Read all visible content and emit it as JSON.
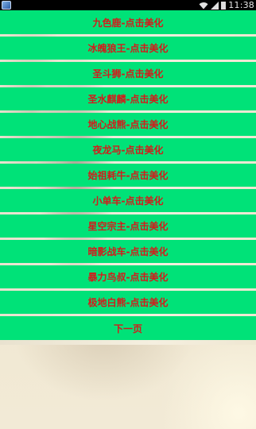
{
  "status_bar": {
    "time": "11:38",
    "icons": [
      "app-icon",
      "wifi-icon",
      "signal-icon",
      "battery-icon"
    ]
  },
  "colors": {
    "button_bg": "#00e278",
    "button_text": "#d41a1a",
    "status_bar_bg": "#000000"
  },
  "menu": {
    "items": [
      {
        "label": "九色鹿-点击美化"
      },
      {
        "label": "冰魄狼王-点击美化"
      },
      {
        "label": "圣斗狮-点击美化"
      },
      {
        "label": "圣水麒麟-点击美化"
      },
      {
        "label": "地心战熊-点击美化"
      },
      {
        "label": "夜龙马-点击美化"
      },
      {
        "label": "始祖耗牛-点击美化"
      },
      {
        "label": "小单车-点击美化"
      },
      {
        "label": "星空宗主-点击美化"
      },
      {
        "label": "暗影战车-点击美化"
      },
      {
        "label": "暴力鸟叔-点击美化"
      },
      {
        "label": "极地白熊-点击美化"
      }
    ],
    "next_page_label": "下一页"
  }
}
